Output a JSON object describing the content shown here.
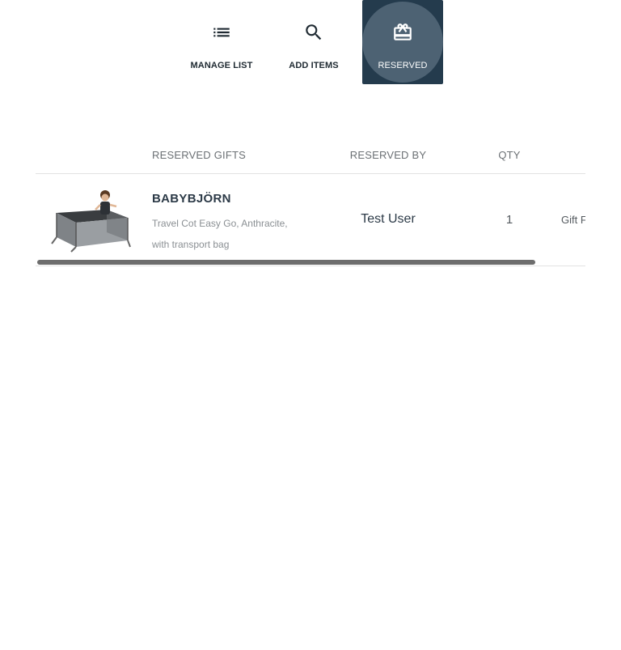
{
  "tabs": {
    "manage": {
      "label": "MANAGE LIST",
      "icon": "list-icon"
    },
    "add": {
      "label": "ADD ITEMS",
      "icon": "search-icon"
    },
    "reserved": {
      "label": "RESERVED",
      "icon": "gift-card-icon",
      "active": true
    }
  },
  "table": {
    "headers": {
      "gifts": "RESERVED GIFTS",
      "reserved_by": "RESERVED BY",
      "qty": "QTY"
    },
    "rows": [
      {
        "image": "travel-cot-product-image",
        "brand": "BABYBJÖRN",
        "description": "Travel Cot Easy Go, Anthracite, with transport bag",
        "reserved_by": "Test User",
        "qty": "1",
        "extra": "Gift F"
      }
    ]
  },
  "colors": {
    "active_tab_bg": "#243b4d",
    "active_tab_ripple": "#4d6273",
    "text_dark": "#2c3a47",
    "header_text": "#6b7074",
    "scrollbar": "#6d6d6d"
  }
}
